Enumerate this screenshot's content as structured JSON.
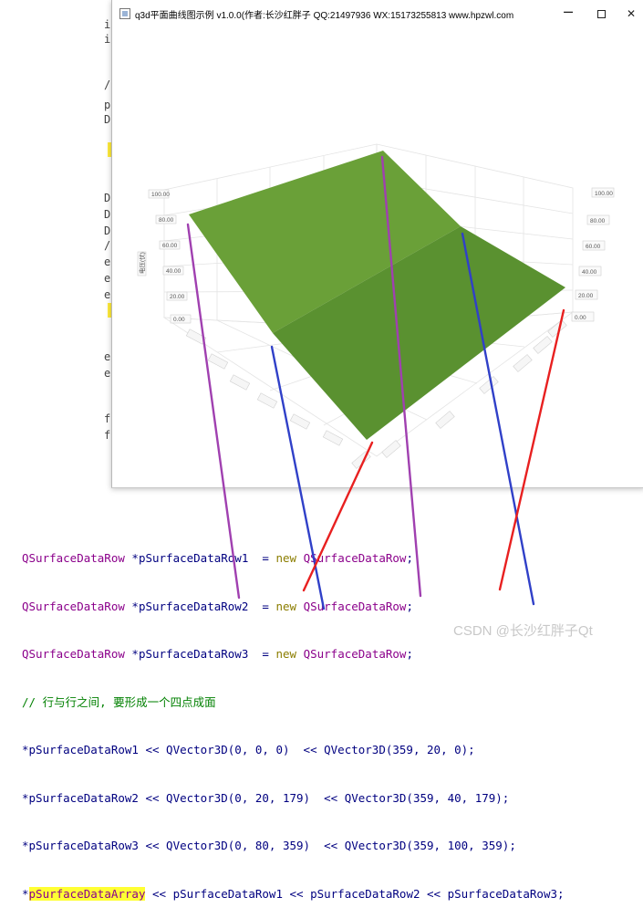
{
  "window": {
    "title": "q3d平面曲线图示例 v1.0.0(作者:长沙红胖子 QQ:21497936 WX:15173255813 www.hpzwl.com",
    "buttons": {
      "minimize": "─",
      "maximize": "",
      "close": "✕"
    }
  },
  "editor_fragments": [
    "i",
    "/",
    "p",
    "D",
    "D",
    "D",
    "D",
    "/",
    "e",
    "e",
    "e",
    "e",
    "f",
    "f"
  ],
  "chart": {
    "left_axis_ticks": [
      "100.00",
      "80.00",
      "60.00",
      "40.00",
      "20.00",
      "0.00"
    ],
    "right_axis_ticks": [
      "100.00",
      "80.00",
      "60.00",
      "40.00",
      "20.00",
      "0.00"
    ],
    "vertical_axis_title": "电压(伏)",
    "surface_color": "#6aa038",
    "surface_shade_color": "#5a9130"
  },
  "code": {
    "lines": [
      {
        "type": "QSurfaceDataRow",
        "rest": " *pSurfaceDataRow1  = ",
        "kw": "new",
        "type2": " QSurfaceDataRow",
        "end": ";"
      },
      {
        "type": "QSurfaceDataRow",
        "rest": " *pSurfaceDataRow2  = ",
        "kw": "new",
        "type2": " QSurfaceDataRow",
        "end": ";"
      },
      {
        "type": "QSurfaceDataRow",
        "rest": " *pSurfaceDataRow3  = ",
        "kw": "new",
        "type2": " QSurfaceDataRow",
        "end": ";"
      }
    ],
    "comment": "// 行与行之间, 要形成一个四点成面",
    "row1": "*pSurfaceDataRow1 << QVector3D(0, 0, 0)  << QVector3D(359, 20, 0);",
    "row2": "*pSurfaceDataRow2 << QVector3D(0, 20, 179)  << QVector3D(359, 40, 179);",
    "row3": "*pSurfaceDataRow3 << QVector3D(0, 80, 359)  << QVector3D(359, 100, 359);",
    "array_star": "*",
    "array_name": "pSurfaceDataArray",
    "array_rest": " << pSurfaceDataRow1 << pSurfaceDataRow2 << pSurfaceDataRow3;"
  },
  "watermark": "CSDN @长沙红胖子Qt",
  "annotation_colors": {
    "purple": "#a040b0",
    "blue": "#3040c8",
    "red": "#e82020"
  }
}
